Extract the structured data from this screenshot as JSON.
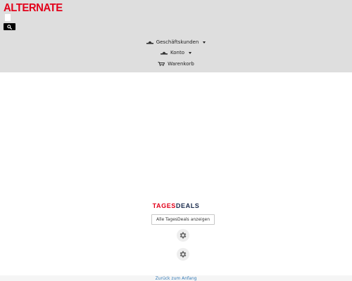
{
  "brand": {
    "logo_text": "ALTERNATE",
    "color": "#e2001a"
  },
  "header": {
    "search_icon": "search-icon"
  },
  "nav": {
    "business": {
      "label": "Geschäftskunden",
      "icon": "user-icon"
    },
    "account": {
      "label": "Konto",
      "icon": "user-icon"
    },
    "cart": {
      "label": "Warenkorb",
      "icon": "cart-icon"
    }
  },
  "deals": {
    "title_part1": "TAGES",
    "title_part2": "DEALS",
    "button_label": "Alle TagesDeals anzeigen"
  },
  "footer": {
    "back_to_top": "Zurück zum Anfang"
  }
}
